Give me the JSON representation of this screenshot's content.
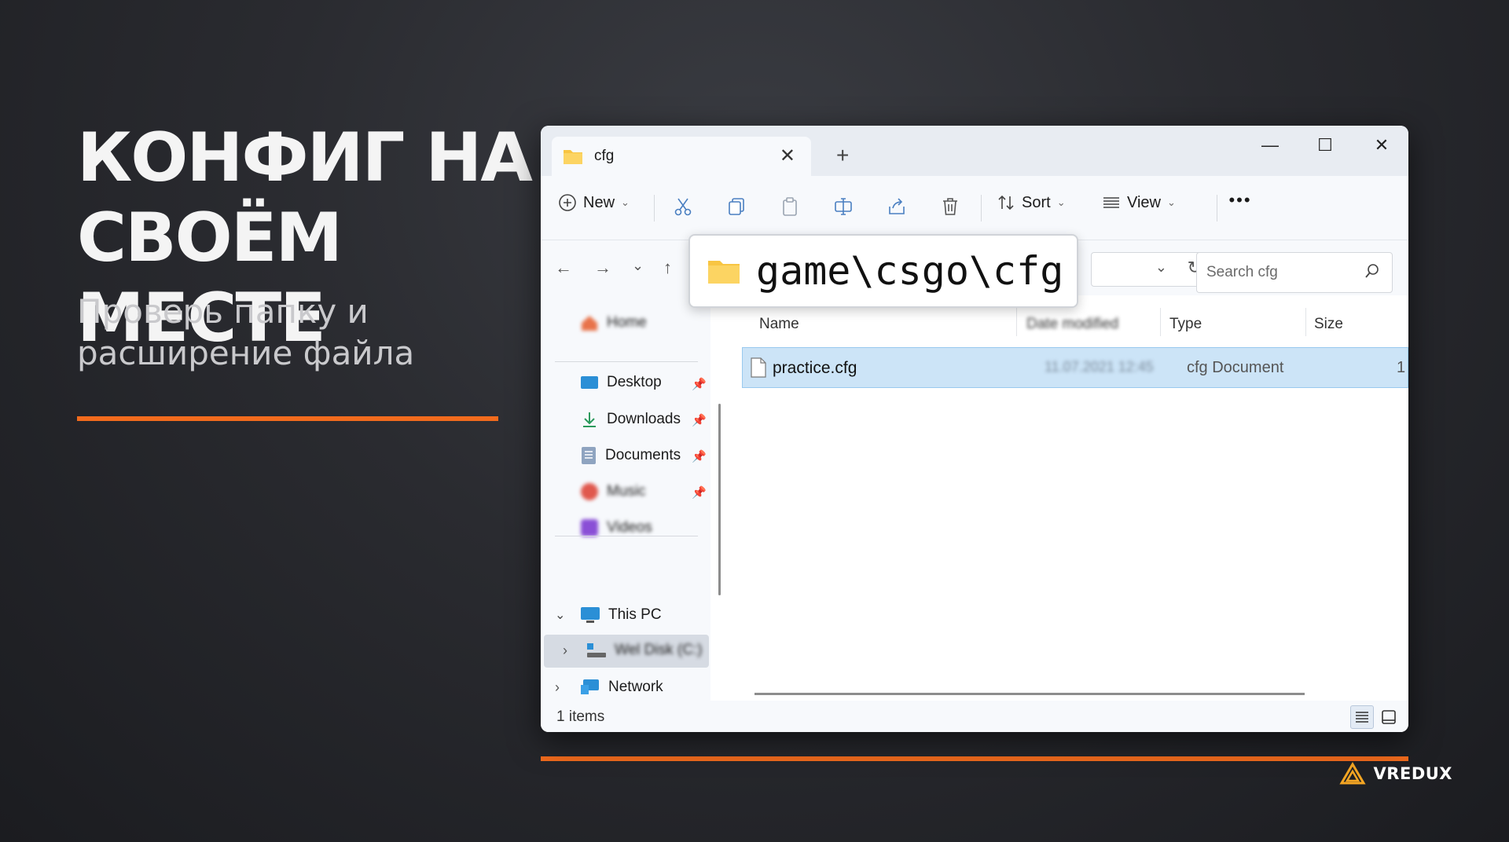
{
  "slide": {
    "headline": "КОНФИГ НА СВОЁМ МЕСТЕ",
    "subline": "Проверь папку и расширение файла",
    "brand": "VREDUX",
    "accent_color": "#f26b1d"
  },
  "window": {
    "tab_title": "cfg",
    "toolbar": {
      "new_label": "New",
      "sort_label": "Sort",
      "view_label": "View",
      "more_label": "•••"
    },
    "path_overlay": "game\\csgo\\cfg",
    "search_placeholder": "Search cfg",
    "sidebar": {
      "home": "Home",
      "quick": [
        "Desktop",
        "Downloads",
        "Documents",
        "Music",
        "Videos"
      ],
      "this_pc": "This PC",
      "disk": "Wel Disk (C:)",
      "network": "Network"
    },
    "columns": {
      "name": "Name",
      "date": "Date modified",
      "type": "Type",
      "size": "Size"
    },
    "files": [
      {
        "name": "practice.cfg",
        "date": "11.07.2021 12:45",
        "type": "cfg Document",
        "size": "1"
      }
    ],
    "status": "1 items"
  }
}
